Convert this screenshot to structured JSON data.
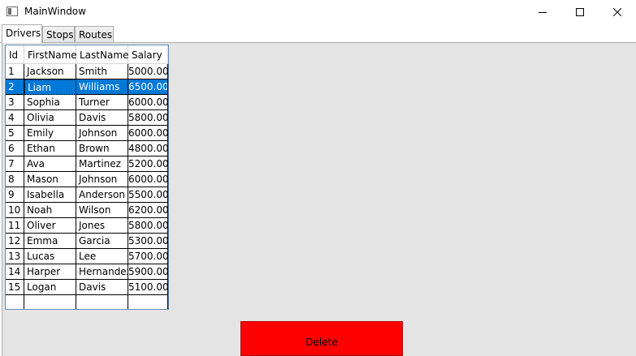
{
  "window": {
    "title": "MainWindow"
  },
  "tabs": [
    {
      "label": "Drivers",
      "selected": true
    },
    {
      "label": "Stops",
      "selected": false
    },
    {
      "label": "Routes",
      "selected": false
    }
  ],
  "grid": {
    "columns": [
      "Id",
      "FirstName",
      "LastName",
      "Salary"
    ],
    "rows": [
      [
        "1",
        "Jackson",
        "Smith",
        "5000.00"
      ],
      [
        "2",
        "Liam",
        "Williams",
        "6500.00"
      ],
      [
        "3",
        "Sophia",
        "Turner",
        "6000.00"
      ],
      [
        "4",
        "Olivia",
        "Davis",
        "5800.00"
      ],
      [
        "5",
        "Emily",
        "Johnson",
        "6000.00"
      ],
      [
        "6",
        "Ethan",
        "Brown",
        "4800.00"
      ],
      [
        "7",
        "Ava",
        "Martinez",
        "5200.00"
      ],
      [
        "8",
        "Mason",
        "Johnson",
        "6000.00"
      ],
      [
        "9",
        "Isabella",
        "Anderson",
        "5500.00"
      ],
      [
        "10",
        "Noah",
        "Wilson",
        "6200.00"
      ],
      [
        "11",
        "Oliver",
        "Jones",
        "5800.00"
      ],
      [
        "12",
        "Emma",
        "Garcia",
        "5300.00"
      ],
      [
        "13",
        "Lucas",
        "Lee",
        "5700.00"
      ],
      [
        "14",
        "Harper",
        "Hernandez",
        "5900.00"
      ],
      [
        "15",
        "Logan",
        "Davis",
        "5100.00"
      ]
    ],
    "selected_row_index": 1
  },
  "actions": {
    "delete_label": "Delete"
  },
  "colors": {
    "selection": "#0078d7",
    "delete_button": "#ff0000",
    "content_bg": "#e5e5e5"
  },
  "icons": {
    "window": "app-window-icon",
    "minimize": "minimize-icon",
    "maximize": "maximize-icon",
    "close": "close-icon"
  }
}
